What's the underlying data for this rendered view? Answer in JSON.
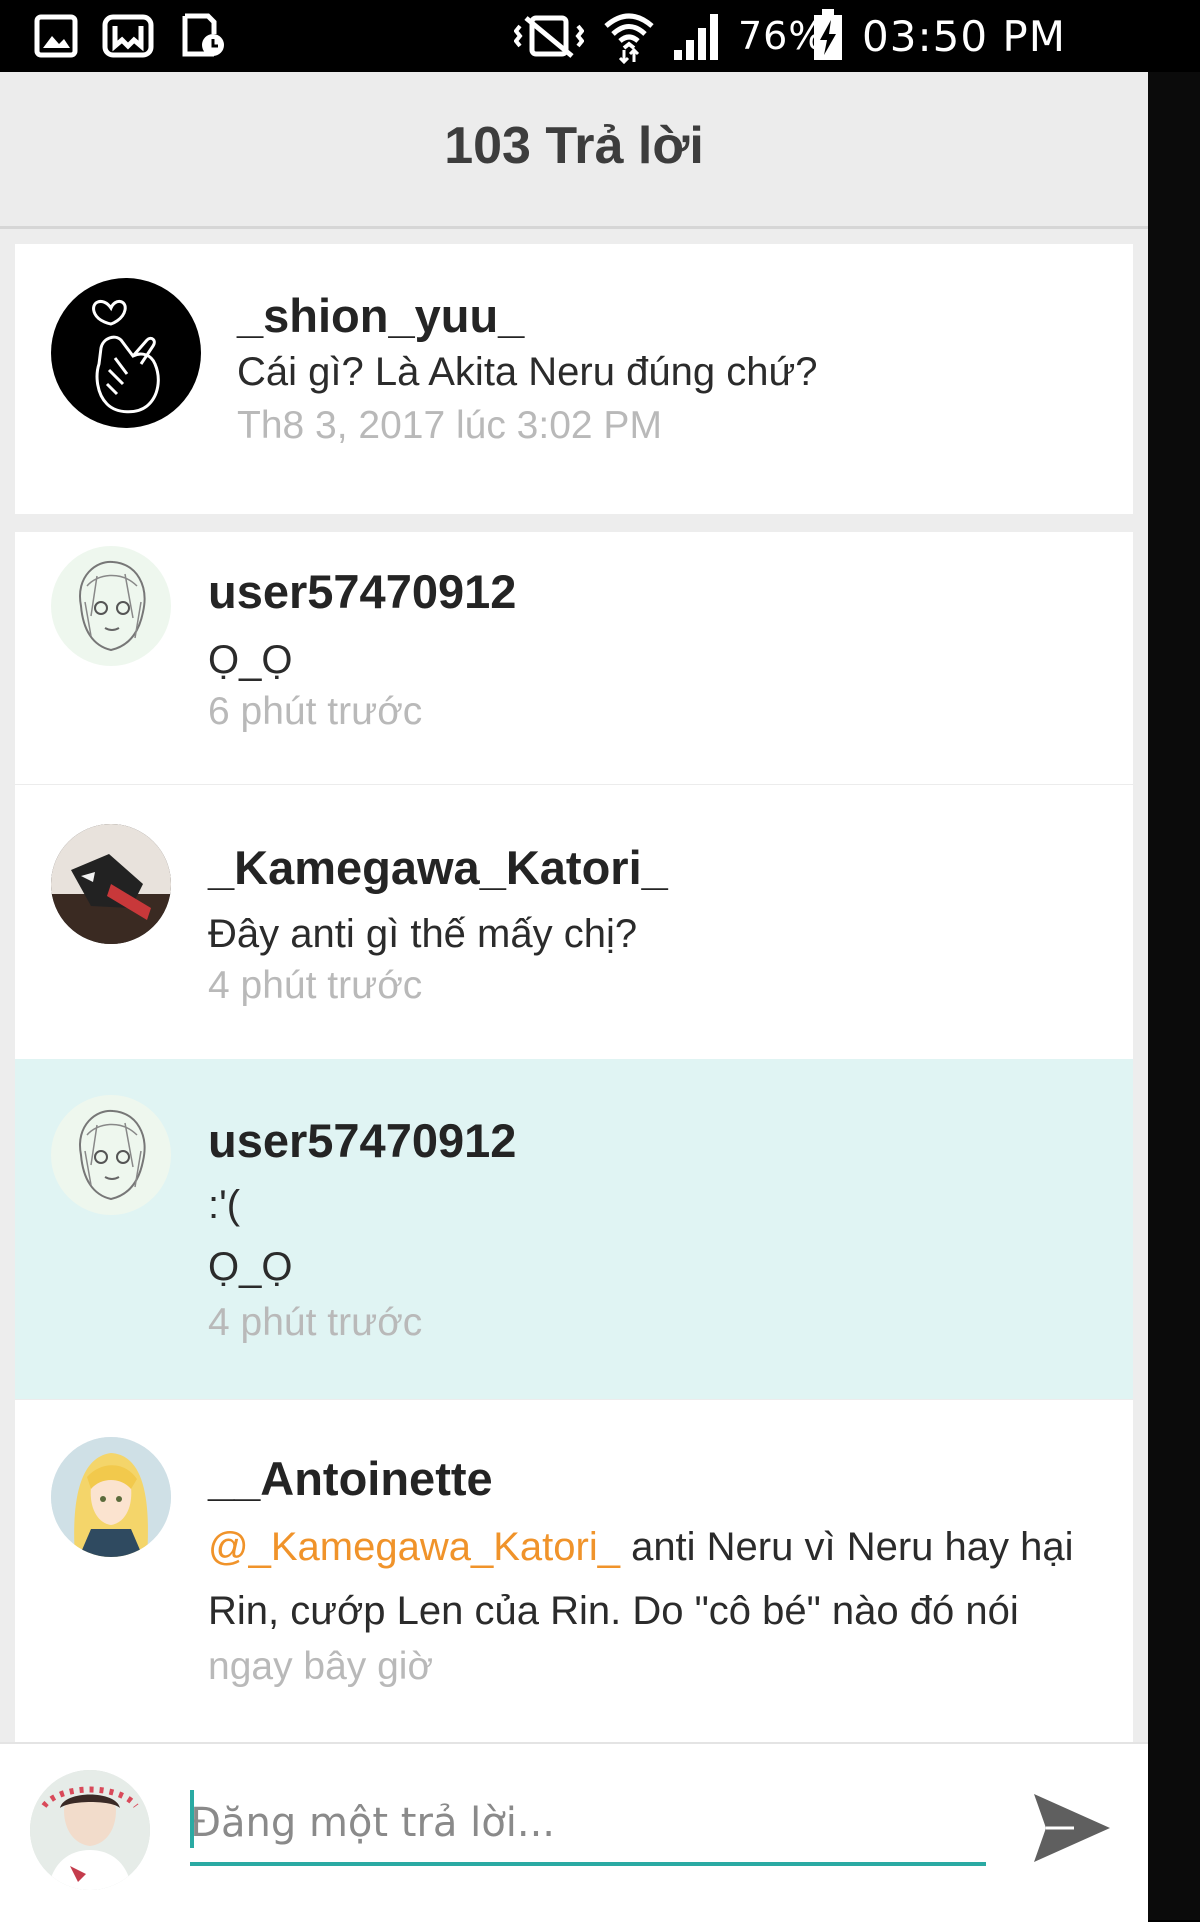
{
  "status_bar": {
    "battery": "76%",
    "time": "03:50 PM",
    "icons": [
      "gallery-icon",
      "wattpad-icon",
      "screenshot-icon",
      "vibrate-icon",
      "wifi-icon",
      "signal-icon",
      "battery-charging-icon"
    ]
  },
  "header": {
    "title": "103 Trả lời"
  },
  "original_comment": {
    "username": "_shion_yuu_",
    "text": "Cái gì? Là Akita Neru đúng chứ?",
    "timestamp": "Th8 3, 2017 lúc 3:02 PM"
  },
  "replies": [
    {
      "username": "user57470912",
      "lines": [
        "Ọ_Ọ"
      ],
      "timestamp": "6 phút trước"
    },
    {
      "username": "_Kamegawa_Katori_",
      "lines": [
        "Đây anti gì thế mấy chị?"
      ],
      "timestamp": "4 phút trước"
    },
    {
      "username": "user57470912",
      "lines": [
        ":'(",
        "Ọ_Ọ"
      ],
      "timestamp": "4 phút trước",
      "highlighted": true
    },
    {
      "username": "__Antoinette",
      "mention": "@_Kamegawa_Katori_",
      "line1_rest": " anti Neru vì Neru hay hại",
      "line2": "Rin, cướp Len của Rin. Do \"cô bé\" nào đó nói",
      "timestamp": "ngay bây giờ"
    }
  ],
  "composer": {
    "placeholder": "Đăng một trả lời..."
  },
  "colors": {
    "accent": "#2aaaa3",
    "mention": "#f0932a",
    "highlight_row": "#e0f4f3",
    "timestamp": "#b9b9b9"
  }
}
